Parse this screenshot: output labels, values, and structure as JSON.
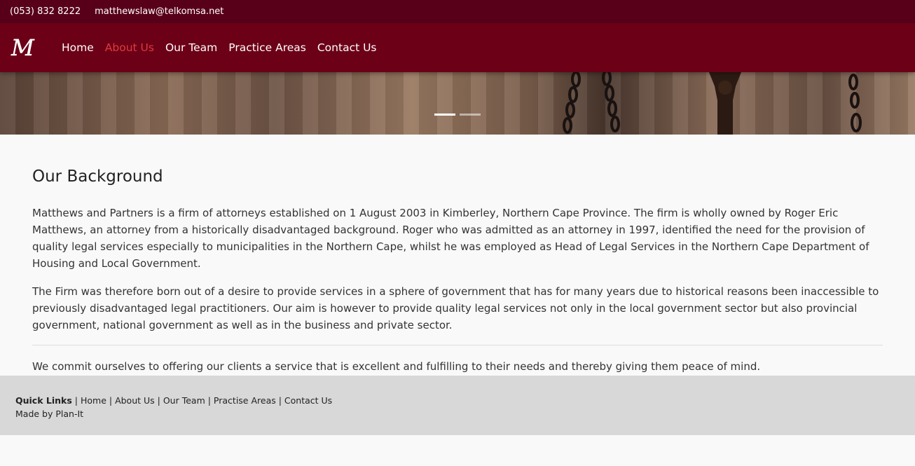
{
  "topbar": {
    "phone": "(053) 832 8222",
    "email": "matthewslaw@telkomsa.net"
  },
  "nav": {
    "logo_letter": "M",
    "items": [
      {
        "label": "Home"
      },
      {
        "label": "About Us"
      },
      {
        "label": "Our Team"
      },
      {
        "label": "Practice Areas"
      },
      {
        "label": "Contact Us"
      }
    ],
    "active_index": 1
  },
  "hero": {
    "slides": 2,
    "active_slide": 1
  },
  "main": {
    "title": "Our Background",
    "paragraphs": [
      "Matthews and Partners is a firm of attorneys established on 1 August 2003 in Kimberley, Northern Cape Province. The firm is wholly owned by Roger Eric Matthews, an attorney from a historically disadvantaged background. Roger who was admitted as an attorney in 1997, identified the need for the provision of quality legal services especially to municipalities in the Northern Cape, whilst he was employed as Head of Legal Services in the Northern Cape Department of Housing and Local Government.",
      "The Firm was therefore born out of a desire to provide services in a sphere of government that has for many years due to historical reasons been inaccessible to previously disadvantaged legal practitioners. Our aim is however to provide quality legal services not only in the local government sector but also provincial government, national government as well as in the business and private sector."
    ],
    "commitment": "We commit ourselves to offering our clients a service that is excellent and fulfilling to their needs and thereby giving them peace of mind."
  },
  "footer": {
    "quick_links_label": "Quick Links",
    "separator": " | ",
    "links": [
      {
        "label": "Home"
      },
      {
        "label": "About Us"
      },
      {
        "label": "Our Team"
      },
      {
        "label": "Practise Areas"
      },
      {
        "label": "Contact Us"
      }
    ],
    "credit": "Made by Plan-It"
  },
  "colors": {
    "topbar_bg": "#58001a",
    "navbar_bg": "#6c0017",
    "active_link": "#e03a3e",
    "footer_bg": "#d8d8d8"
  }
}
